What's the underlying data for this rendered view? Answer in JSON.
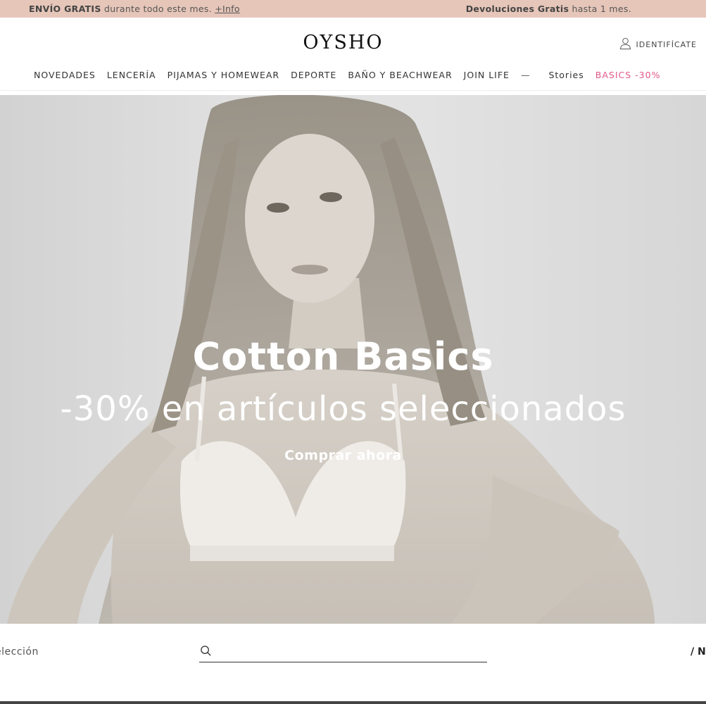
{
  "announcement": {
    "left_bold": "ENVÍO GRATIS",
    "left_text": " durante todo este mes. ",
    "left_link": "+Info",
    "right_bold": "Devoluciones Gratis",
    "right_text": " hasta 1 mes."
  },
  "header": {
    "logo": "OYSHO",
    "login_label": "IDENTIFÍCATE",
    "login_icon": "user-icon"
  },
  "nav": {
    "items": [
      "NOVEDADES",
      "LENCERÍA",
      "PIJAMAS Y HOMEWEAR",
      "DEPORTE",
      "BAÑO Y BEACHWEAR",
      "JOIN LIFE"
    ],
    "separator": "—",
    "stories": "Stories",
    "promo": "BASICS -30%",
    "promo_color": "#e2588a"
  },
  "hero": {
    "title": "Cotton Basics",
    "subtitle": "-30% en artículos seleccionados",
    "cta": "Comprar ahora"
  },
  "filters": {
    "label": "elección",
    "search_icon": "search-icon",
    "search_value": "",
    "right_cut": "/ N"
  },
  "colors": {
    "announcement_bg": "#e6c6b9",
    "promo": "#e2588a"
  }
}
